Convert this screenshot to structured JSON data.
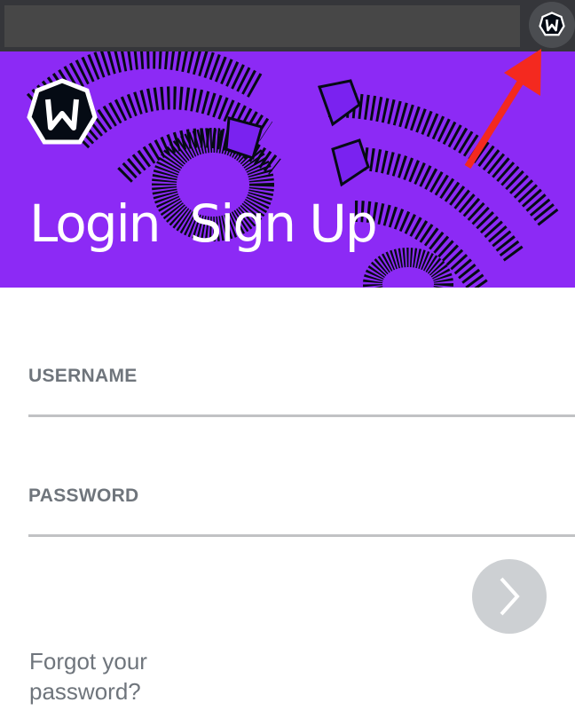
{
  "browser": {
    "address_value": "",
    "extension_icon": "windscribe-logo-icon"
  },
  "banner": {
    "background_color": "#8c2af5",
    "logo_icon": "windscribe-logo-icon",
    "tabs": [
      {
        "label": "Login"
      },
      {
        "label": "Sign Up"
      }
    ]
  },
  "form": {
    "username_label": "USERNAME",
    "username_value": "",
    "password_label": "PASSWORD",
    "password_value": "",
    "submit_icon": "chevron-right-icon",
    "forgot_line1": "Forgot your",
    "forgot_line2": "password?"
  },
  "annotation": {
    "arrow_color": "#f4291f"
  }
}
